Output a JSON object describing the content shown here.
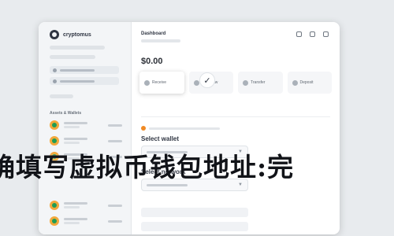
{
  "sidebar": {
    "brand": "cryptomus",
    "section_heading": "Assets & Wallets"
  },
  "main": {
    "title": "Dashboard",
    "balance": "$0.00"
  },
  "actions": [
    {
      "label": "Receive",
      "icon": "arrow-down-icon"
    },
    {
      "label": "Withdraw",
      "icon": "arrow-up-icon"
    },
    {
      "label": "Transfer",
      "icon": "swap-icon"
    },
    {
      "label": "Deposit",
      "icon": "wallet-icon"
    }
  ],
  "wallet": {
    "select_wallet_title": "Select wallet",
    "select_network_title": "Select network"
  },
  "overlay_text": "确填写虚拟币钱包地址:完",
  "colors": {
    "accent_coin_outer": "#f2a93b",
    "accent_coin_inner": "#1f9d55",
    "warning": "#f08a24"
  }
}
